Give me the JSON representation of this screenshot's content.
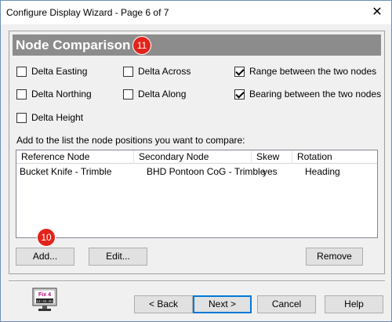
{
  "window": {
    "title": "Configure Display Wizard - Page 6 of 7",
    "close_glyph": "✕"
  },
  "header": {
    "title": "Node Comparison",
    "badge": "11"
  },
  "options": [
    {
      "label": "Delta Easting",
      "checked": false
    },
    {
      "label": "Delta Across",
      "checked": false
    },
    {
      "label": "Range between the two nodes",
      "checked": true
    },
    {
      "label": "Delta Northing",
      "checked": false
    },
    {
      "label": "Delta Along",
      "checked": false
    },
    {
      "label": "Bearing between the two nodes",
      "checked": true
    },
    {
      "label": "Delta Height",
      "checked": false
    }
  ],
  "instruction": "Add to the list the node positions you want to compare:",
  "table": {
    "columns": [
      "Reference Node",
      "Secondary Node",
      "Skew",
      "Rotation"
    ],
    "rows": [
      [
        "Bucket Knife - Trimble",
        "BHD Pontoon CoG - Trimble",
        "yes",
        "Heading"
      ]
    ]
  },
  "list_buttons": {
    "add": "Add...",
    "add_badge": "10",
    "edit": "Edit...",
    "remove": "Remove"
  },
  "footer": {
    "icon_label": "Fix 4",
    "icon_time": "12:31:01",
    "back": "< Back",
    "next": "Next >",
    "cancel": "Cancel",
    "help": "Help"
  },
  "colors": {
    "header_band": "#8c8c8c",
    "badge": "#e2231a",
    "default_button_border": "#0078d7"
  }
}
